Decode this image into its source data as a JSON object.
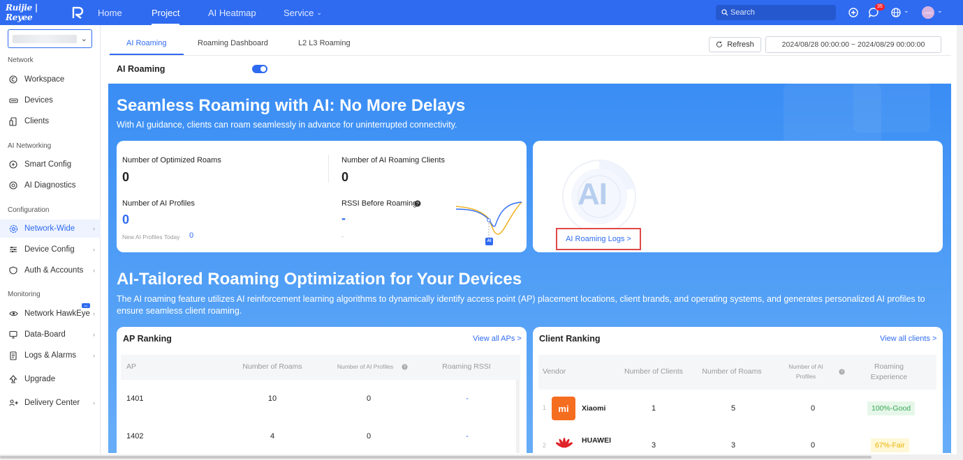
{
  "brand": {
    "logo_text": "Ruijie | Reyee"
  },
  "topnav": {
    "items": [
      {
        "label": "Home"
      },
      {
        "label": "Project"
      },
      {
        "label": "AI Heatmap"
      },
      {
        "label": "Service"
      }
    ],
    "search_placeholder": "Search",
    "notification_count": "35",
    "avatar_text": "LOGO",
    "accent": "#2f6bf1"
  },
  "sidebar": {
    "sections": {
      "network": "Network",
      "ai_networking": "AI Networking",
      "configuration": "Configuration",
      "monitoring": "Monitoring"
    },
    "items": {
      "workspace": "Workspace",
      "devices": "Devices",
      "clients": "Clients",
      "smart_config": "Smart Config",
      "ai_diagnostics": "AI Diagnostics",
      "network_wide": "Network-Wide",
      "device_config": "Device Config",
      "auth_accounts": "Auth & Accounts",
      "network_hawkeye": "Network HawkEye",
      "data_board": "Data-Board",
      "logs_alarms": "Logs & Alarms",
      "upgrade": "Upgrade",
      "delivery_center": "Delivery Center"
    }
  },
  "tabs": [
    {
      "label": "AI Roaming"
    },
    {
      "label": "Roaming Dashboard"
    },
    {
      "label": "L2 L3 Roaming"
    }
  ],
  "toolbar": {
    "refresh_label": "Refresh",
    "date_range": "2024/08/28 00:00:00 ~ 2024/08/29 00:00:00"
  },
  "ai_roaming": {
    "label": "AI Roaming",
    "enabled": true
  },
  "hero": {
    "title": "Seamless Roaming with AI: No More Delays",
    "subtitle": "With AI guidance, clients can roam seamlessly in advance for uninterrupted connectivity."
  },
  "stats": {
    "optimized_roams_label": "Number of Optimized Roams",
    "optimized_roams_value": "0",
    "ai_clients_label": "Number of AI Roaming Clients",
    "ai_clients_value": "0",
    "ai_profiles_label": "Number of AI Profiles",
    "ai_profiles_value": "0",
    "new_profiles_label": "New AI Profiles Today",
    "new_profiles_value": "0",
    "rssi_label": "RSSI Before Roaming",
    "rssi_value": "-",
    "rssi_sub": "-",
    "chart_badge": "AI"
  },
  "ai_panel": {
    "emblem_text": "AI",
    "logs_link": "AI Roaming Logs >"
  },
  "optimization": {
    "title": "AI-Tailored Roaming Optimization for Your Devices",
    "description": "The AI roaming feature utilizes AI reinforcement learning algorithms to dynamically identify access point (AP) placement locations, client brands, and operating systems, and generates personalized AI profiles to ensure seamless client roaming."
  },
  "ap_ranking": {
    "title": "AP Ranking",
    "link": "View all APs >",
    "columns": [
      "AP",
      "Number of Roams",
      "Number of AI Profiles",
      "Roaming RSSI"
    ],
    "rows": [
      {
        "ap": "1401",
        "roams": "10",
        "profiles": "0",
        "rssi": "-"
      },
      {
        "ap": "1402",
        "roams": "4",
        "profiles": "0",
        "rssi": "-"
      }
    ]
  },
  "client_ranking": {
    "title": "Client Ranking",
    "link": "View all clients >",
    "columns": [
      "Vendor",
      "Number of Clients",
      "Number of Roams",
      "Number of AI Profiles",
      "Roaming Experience"
    ],
    "rows": [
      {
        "rank": "1",
        "vendor": "Xiaomi",
        "clients": "1",
        "roams": "5",
        "profiles": "0",
        "experience": "100%-Good",
        "logo_text": "mi",
        "logo_color": "#f56d1f",
        "exp_bg": "#e6f7ea",
        "exp_color": "#36a852"
      },
      {
        "rank": "2",
        "vendor": "HUAWEI",
        "clients": "3",
        "roams": "3",
        "profiles": "0",
        "experience": "67%-Fair",
        "logo_text": "",
        "logo_color": "#e0242a",
        "exp_bg": "#fff7d6",
        "exp_color": "#e8b300"
      }
    ]
  }
}
